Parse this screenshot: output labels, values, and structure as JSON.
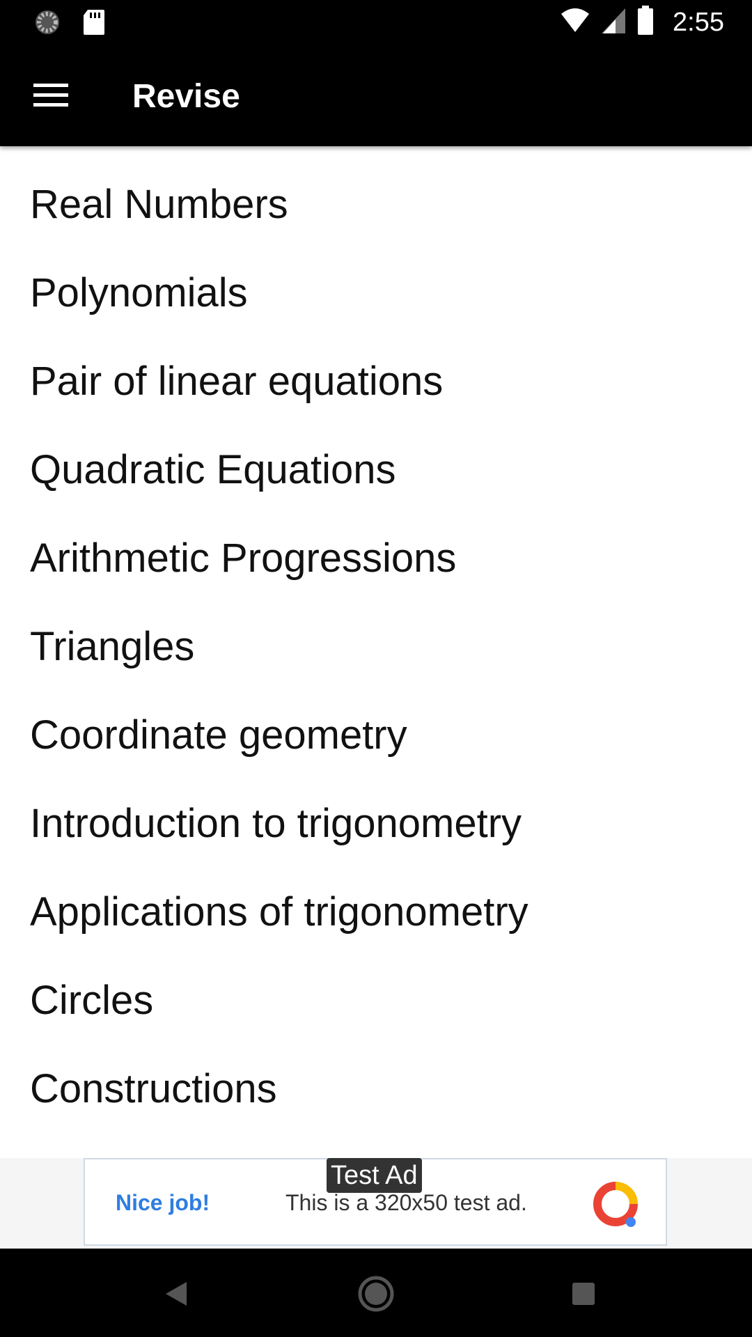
{
  "status_bar": {
    "time": "2:55",
    "icons": [
      "loading-icon",
      "sd-card-icon",
      "wifi-icon",
      "signal-icon",
      "battery-icon"
    ]
  },
  "app_bar": {
    "title": "Revise",
    "menu_icon": "hamburger-menu-icon"
  },
  "topics": [
    "Real Numbers",
    "Polynomials",
    "Pair of linear equations",
    "Quadratic Equations",
    "Arithmetic Progressions",
    "Triangles",
    "Coordinate geometry",
    "Introduction to trigonometry",
    "Applications of trigonometry",
    "Circles",
    "Constructions"
  ],
  "ad": {
    "label": "Test Ad",
    "headline": "Nice job!",
    "text": "This is a 320x50 test ad.",
    "headline_color": "#2f7de1"
  },
  "nav_bar": {
    "icons": [
      "back-icon",
      "home-icon",
      "recents-icon"
    ]
  },
  "colors": {
    "app_bar": "#000000",
    "background": "#ffffff"
  }
}
